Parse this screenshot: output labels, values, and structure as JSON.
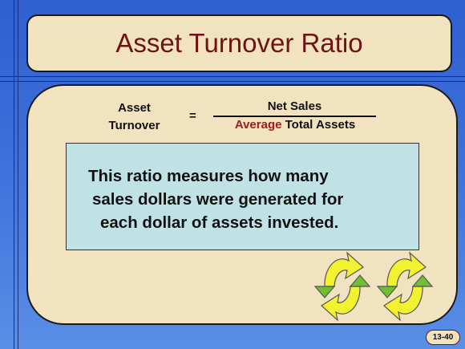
{
  "slide": {
    "title": "Asset Turnover Ratio",
    "slide_number": "13-40"
  },
  "formula": {
    "lhs_line1": "Asset",
    "lhs_line2": "Turnover",
    "equals": "=",
    "numerator": "Net Sales",
    "denominator_accent": "Average",
    "denominator_rest": " Total Assets"
  },
  "explanation": {
    "line1": "This ratio measures how many",
    "line2": "sales dollars were generated for",
    "line3": "each dollar of assets invested."
  },
  "icons": {
    "cycle_left": "recycle-arrows-icon",
    "cycle_right": "recycle-arrows-icon"
  },
  "colors": {
    "background": "#3f72dc",
    "panel": "#f1e2c0",
    "title_text": "#6e1313",
    "accent_text": "#a01d1d",
    "info_box": "#c1e2e5",
    "arrow_yellow": "#f2f230",
    "arrow_green": "#6fbe34"
  }
}
